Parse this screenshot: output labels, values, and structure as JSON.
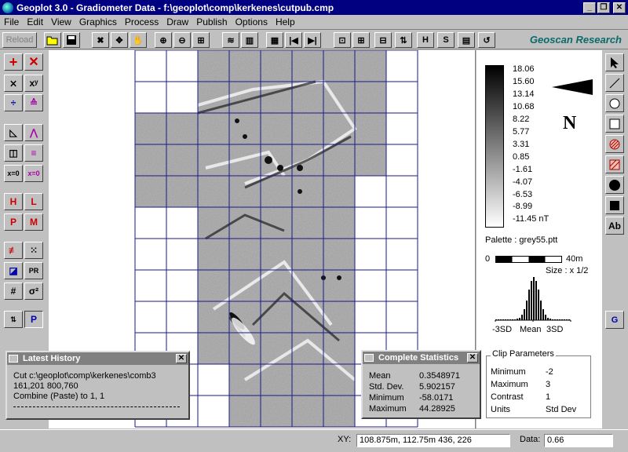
{
  "window": {
    "title": "Geoplot 3.0 - Gradiometer Data  -  f:\\geoplot\\comp\\kerkenes\\cutpub.cmp"
  },
  "menu": [
    "File",
    "Edit",
    "View",
    "Graphics",
    "Process",
    "Draw",
    "Publish",
    "Options",
    "Help"
  ],
  "toolbar": {
    "reload_label": "Reload",
    "brand": "Geoscan Research"
  },
  "legend": {
    "values": [
      "18.06",
      "15.60",
      "13.14",
      "10.68",
      "8.22",
      "5.77",
      "3.31",
      "0.85",
      "-1.61",
      "-4.07",
      "-6.53",
      "-8.99",
      "-11.45  nT"
    ],
    "north_label": "N",
    "palette": "Palette : grey55.ptt",
    "scale_start": "0",
    "scale_end": "40m",
    "size": "Size : x 1/2",
    "hist_left": "-3SD",
    "hist_mid": "Mean",
    "hist_right": "3SD"
  },
  "clip": {
    "title": "Clip Parameters",
    "rows": [
      {
        "label": "Minimum",
        "value": "-2"
      },
      {
        "label": "Maximum",
        "value": "3"
      },
      {
        "label": "Contrast",
        "value": "1"
      },
      {
        "label": "Units",
        "value": "Std Dev"
      }
    ]
  },
  "history": {
    "title": "Latest History",
    "lines": [
      "Cut  c:\\geoplot\\comp\\kerkenes\\comb3",
      "161,201 800,760",
      "Combine (Paste) to  1, 1"
    ]
  },
  "stats": {
    "title": "Complete Statistics",
    "rows": [
      {
        "label": "Mean",
        "value": "0.3548971"
      },
      {
        "label": "Std. Dev.",
        "value": "5.902157"
      },
      {
        "label": "Minimum",
        "value": "-58.0171"
      },
      {
        "label": "Maximum",
        "value": "44.28925"
      }
    ]
  },
  "status": {
    "xy_label": "XY:",
    "xy_value": "108.875m,  112.75m      436,  226",
    "data_label": "Data:",
    "data_value": "0.66"
  },
  "right_tools": {
    "text_tool": "Ab",
    "g_tool": "G"
  },
  "left_tools": {
    "pr": "PR"
  }
}
